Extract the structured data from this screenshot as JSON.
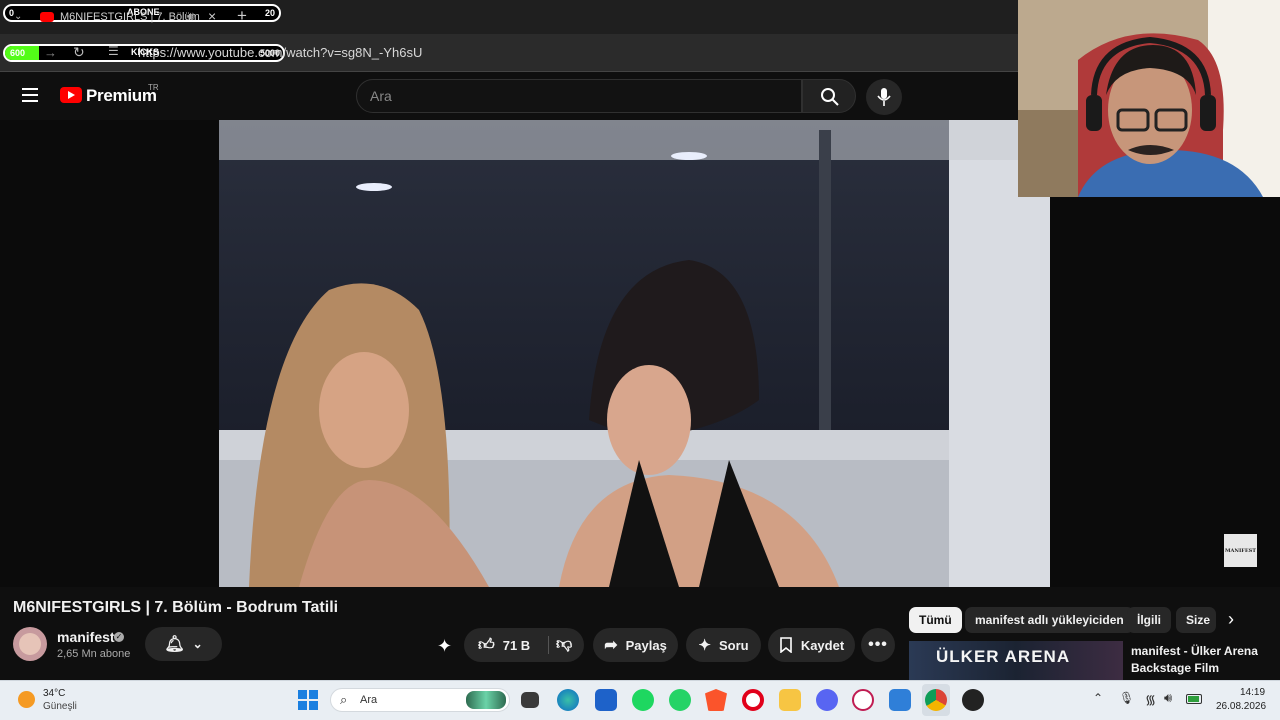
{
  "overlay": {
    "left_counter": "0",
    "right_counter": "20",
    "abone_label": "ABONE",
    "kicks_label": "KICKS",
    "kicks_start": "600",
    "kicks_goal": "5000"
  },
  "browser": {
    "tab_title": "M6NIFESTGIRLS | 7. Bölüm",
    "url": "https://www.youtube.com/watch?v=sg8N_-Yh6sU"
  },
  "youtube": {
    "logo_text": "Premium",
    "region": "TR",
    "search_placeholder": "Ara"
  },
  "video": {
    "title": "M6NIFESTGIRLS | 7. Bölüm - Bodrum Tatili",
    "watermark": "MANIFEST",
    "channel_name": "manifest",
    "subscribers": "2,65 Mn abone",
    "likes": "71 B",
    "share_label": "Paylaş",
    "ask_label": "Soru",
    "save_label": "Kaydet"
  },
  "chips": [
    "Tümü",
    "manifest adlı yükleyiciden",
    "İlgili",
    "Size"
  ],
  "related": {
    "thumb_text": "ÜLKER ARENA",
    "title": "manifest - Ülker Arena Backstage Film"
  },
  "taskbar": {
    "temperature": "34°C",
    "weather": "Güneşli",
    "search_label": "Ara",
    "time": "14:19",
    "date": "26.08.2026"
  },
  "colors": {
    "yt_red": "#ff0000",
    "kick_green": "#53fc18",
    "taskbar_bg": "#e9eef3"
  }
}
